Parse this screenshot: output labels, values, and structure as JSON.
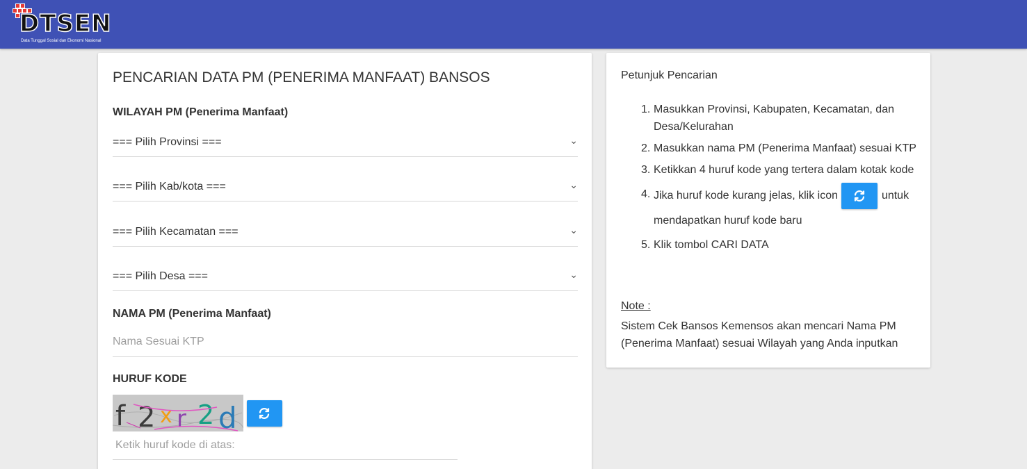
{
  "header": {
    "logo_text": "DTSEN",
    "logo_subtitle": "Data Tunggal Sosial dan Ekonomi Nasional",
    "bar_color": "#3f51b5"
  },
  "form": {
    "title": "PENCARIAN DATA PM (PENERIMA MANFAAT) BANSOS",
    "region_label": "WILAYAH PM (Penerima Manfaat)",
    "selects": {
      "province": "=== Pilih Provinsi ===",
      "regency": "=== Pilih Kab/kota ===",
      "district": "=== Pilih Kecamatan ===",
      "village": "=== Pilih Desa ==="
    },
    "name_label": "NAMA PM (Penerima Manfaat)",
    "name_placeholder": "Nama Sesuai KTP",
    "code_label": "HURUF KODE",
    "captcha_text": "f2xr2d",
    "code_placeholder": "Ketik huruf kode di atas:",
    "icons": {
      "refresh": "refresh-icon",
      "dropdown": "chevron-down-icon"
    },
    "accent_color": "#2196f3"
  },
  "guide": {
    "title": "Petunjuk Pencarian",
    "steps": [
      {
        "num": "1.",
        "text": "Masukkan Provinsi, Kabupaten, Kecamatan, dan Desa/Kelurahan"
      },
      {
        "num": "2.",
        "text": "Masukkan nama PM (Penerima Manfaat) sesuai KTP"
      },
      {
        "num": "3.",
        "text": "Ketikkan 4 huruf kode yang tertera dalam kotak kode"
      },
      {
        "num": "4.",
        "text_before": "Jika huruf kode kurang jelas, klik icon",
        "text_after": "untuk mendapatkan huruf kode baru"
      },
      {
        "num": "5.",
        "text": "Klik tombol CARI DATA"
      }
    ],
    "note_label": "Note :",
    "note_text": "Sistem Cek Bansos Kemensos akan mencari Nama PM (Penerima Manfaat) sesuai Wilayah yang Anda inputkan"
  }
}
